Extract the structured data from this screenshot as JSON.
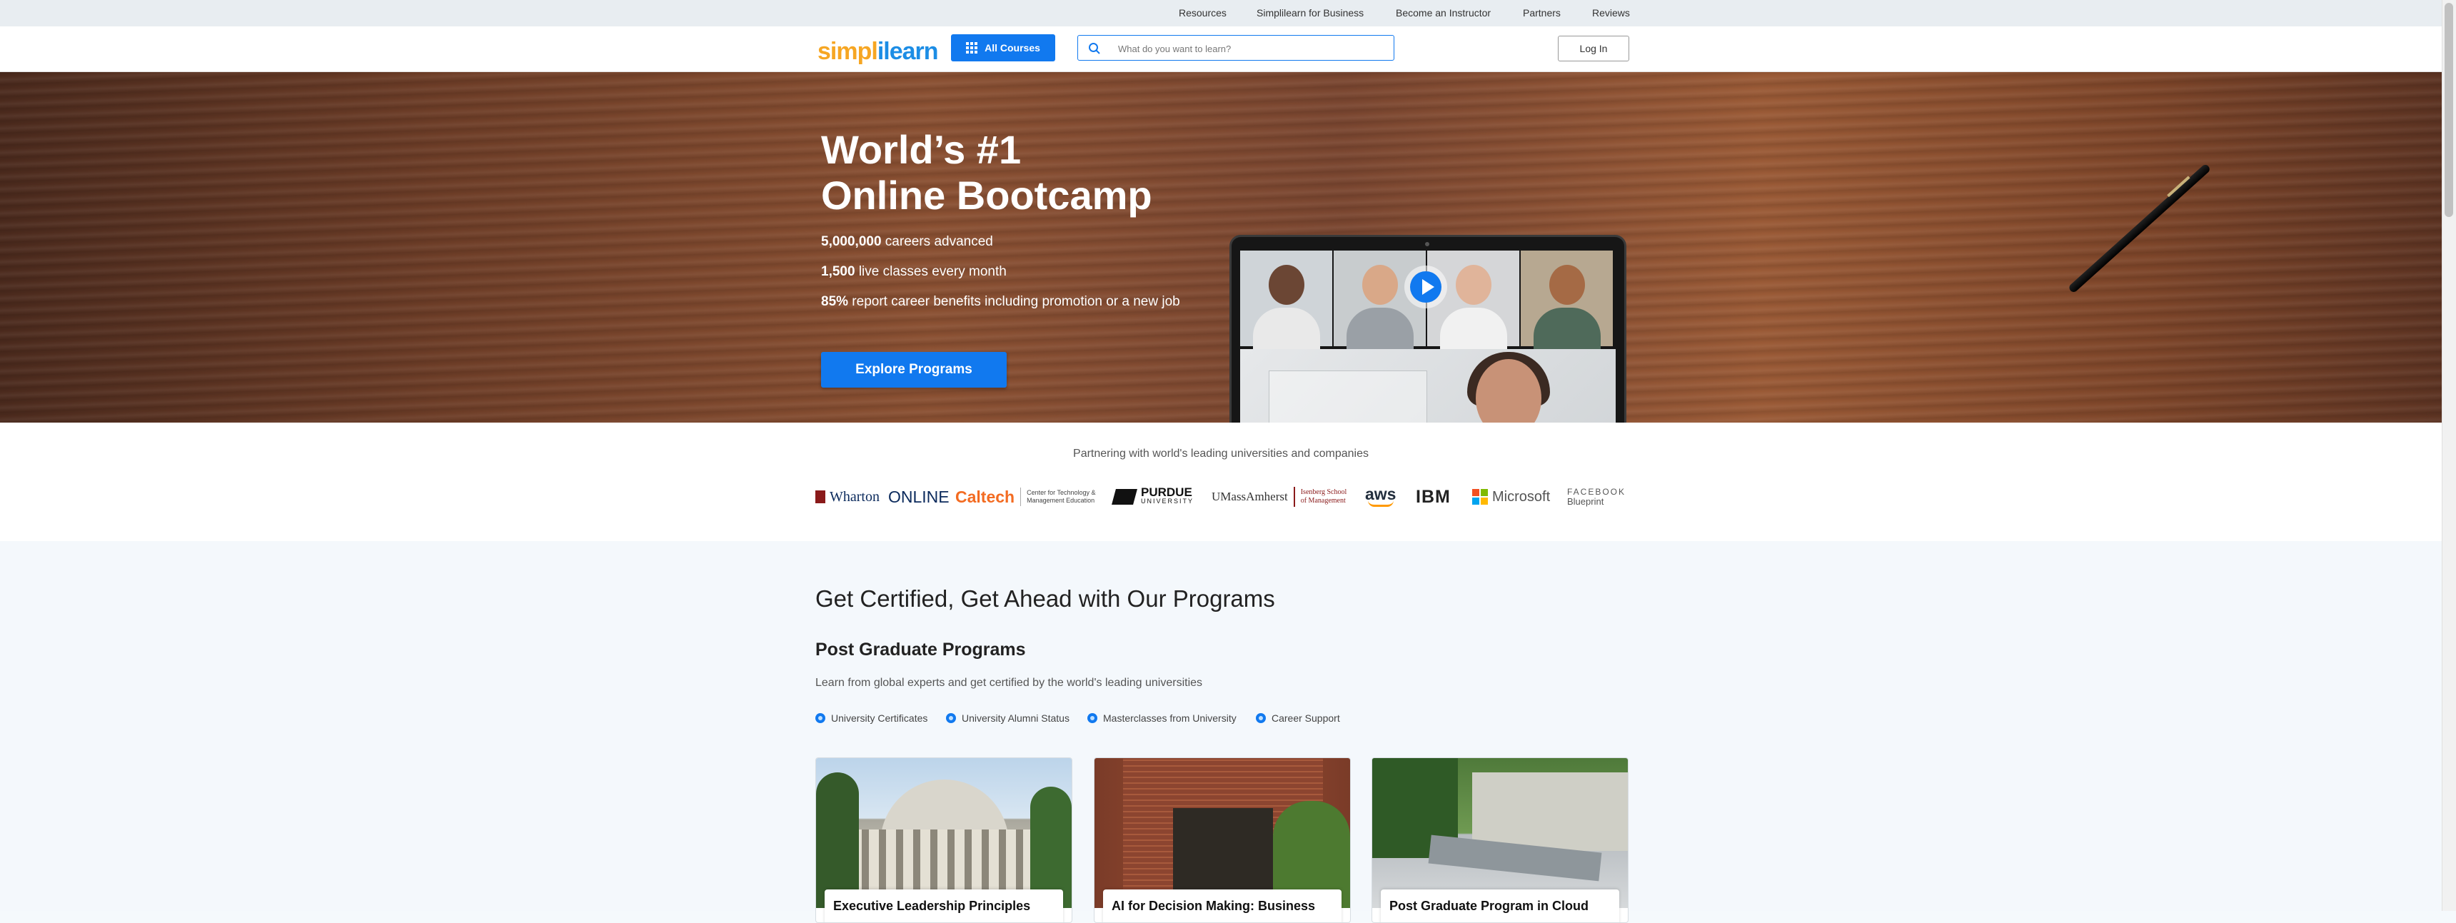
{
  "topbar": {
    "links": [
      "Resources",
      "Simplilearn for Business",
      "Become an Instructor",
      "Partners",
      "Reviews"
    ]
  },
  "navbar": {
    "logo_part1": "simpl",
    "logo_part2": "ilearn",
    "all_courses_label": "All Courses",
    "search_placeholder": "What do you want to learn?",
    "login_label": "Log In"
  },
  "hero": {
    "title_line1": "World’s #1",
    "title_line2": "Online Bootcamp",
    "stats": [
      {
        "bold": "5,000,000",
        "text": " careers advanced"
      },
      {
        "bold": "1,500",
        "text": " live classes every month"
      },
      {
        "bold": "85%",
        "text": " report career benefits including promotion or a new job"
      }
    ],
    "cta_label": "Explore Programs"
  },
  "partners": {
    "title": "Partnering with world's leading universities and companies",
    "logos": [
      {
        "name": "Wharton",
        "text": "Wharton",
        "text2": "ONLINE",
        "color": "#0b2a5c"
      },
      {
        "name": "Caltech",
        "text": "Caltech",
        "text2": "Center for Technology & Management Education",
        "color": "#f36b21"
      },
      {
        "name": "Purdue",
        "text": "PURDUE",
        "text2": "UNIVERSITY",
        "color": "#111111"
      },
      {
        "name": "UMassAmherst",
        "text": "UMassAmherst",
        "text2": "Isenberg School of Management",
        "color": "#8a1a1a"
      },
      {
        "name": "aws",
        "text": "aws",
        "color": "#232f3e"
      },
      {
        "name": "IBM",
        "text": "IBM",
        "color": "#222222"
      },
      {
        "name": "Microsoft",
        "text": "Microsoft",
        "color": "#555555"
      },
      {
        "name": "Facebook Blueprint",
        "text": "FACEBOOK",
        "text2": "Blueprint",
        "color": "#555555"
      }
    ]
  },
  "programs": {
    "section_title": "Get Certified, Get Ahead with Our Programs",
    "subsection_title": "Post Graduate Programs",
    "description": "Learn from global experts and get certified by the world's leading universities",
    "features": [
      "University Certificates",
      "University Alumni Status",
      "Masterclasses from University",
      "Career Support"
    ],
    "cards": [
      {
        "title": "Executive Leadership Principles"
      },
      {
        "title": "AI for Decision Making: Business"
      },
      {
        "title": "Post Graduate Program in Cloud"
      }
    ]
  },
  "colors": {
    "brand_blue": "#1179ef",
    "logo_orange": "#f6a623",
    "logo_blue": "#1c8de5"
  }
}
